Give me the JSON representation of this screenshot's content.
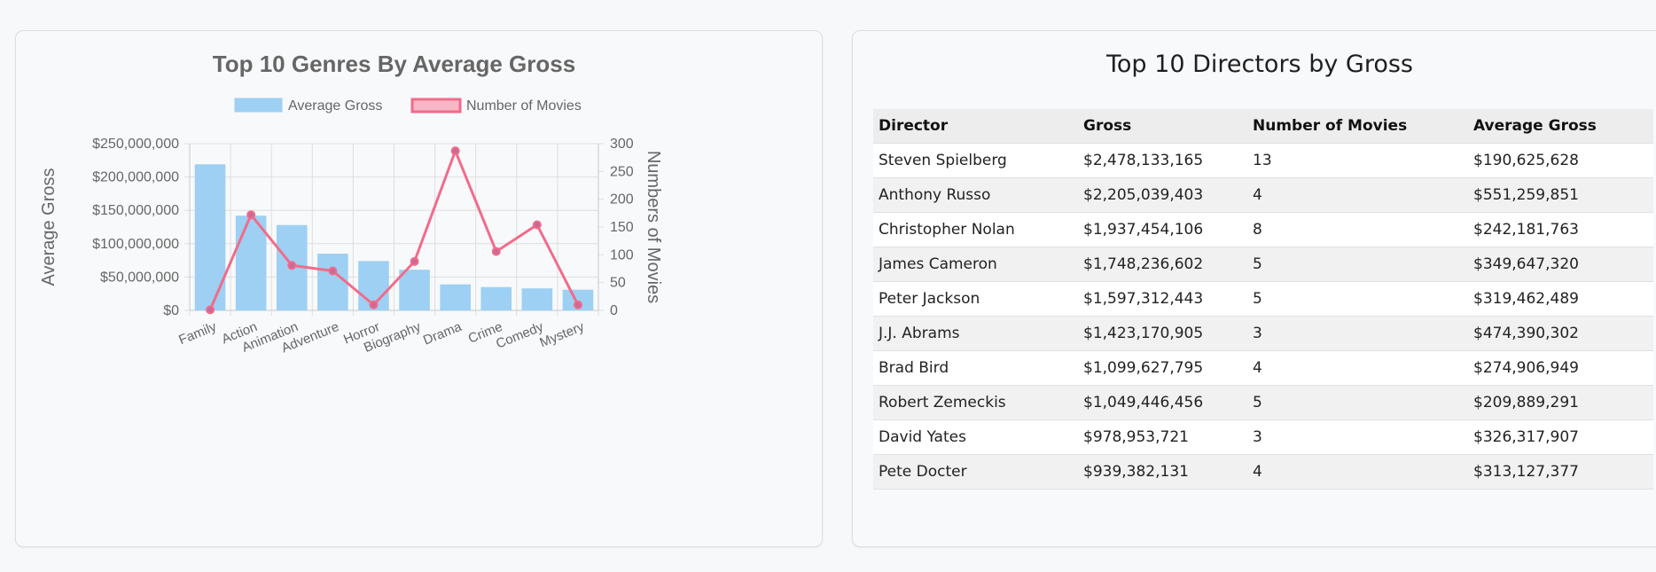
{
  "chart_data": {
    "type": "bar",
    "title": "Top 10 Genres By Average Gross",
    "categories": [
      "Family",
      "Action",
      "Animation",
      "Adventure",
      "Horror",
      "Biography",
      "Drama",
      "Crime",
      "Comedy",
      "Mystery"
    ],
    "series": [
      {
        "name": "Average Gross",
        "type": "bar",
        "axis": "left",
        "color": "#9dd0f3",
        "values": [
          219000000,
          142000000,
          128000000,
          85000000,
          74000000,
          61000000,
          39000000,
          35000000,
          33000000,
          31000000
        ]
      },
      {
        "name": "Number of Movies",
        "type": "line",
        "axis": "right",
        "color": "#f26b8a",
        "values": [
          1,
          172,
          81,
          71,
          10,
          88,
          287,
          106,
          154,
          10
        ]
      }
    ],
    "ylabel": "Average Gross",
    "y2label": "Numbers of Movies",
    "ylim": [
      0,
      250000000
    ],
    "y2lim": [
      0,
      300
    ],
    "yticks": [
      "$0",
      "$50,000,000",
      "$100,000,000",
      "$150,000,000",
      "$200,000,000",
      "$250,000,000"
    ],
    "y2ticks": [
      "0",
      "50",
      "100",
      "150",
      "200",
      "250",
      "300"
    ],
    "grid": true,
    "legend": "top"
  },
  "table": {
    "title": "Top 10 Directors by Gross",
    "columns": [
      "Director",
      "Gross",
      "Number of Movies",
      "Average Gross"
    ],
    "rows": [
      [
        "Steven Spielberg",
        "$2,478,133,165",
        "13",
        "$190,625,628"
      ],
      [
        "Anthony Russo",
        "$2,205,039,403",
        "4",
        "$551,259,851"
      ],
      [
        "Christopher Nolan",
        "$1,937,454,106",
        "8",
        "$242,181,763"
      ],
      [
        "James Cameron",
        "$1,748,236,602",
        "5",
        "$349,647,320"
      ],
      [
        "Peter Jackson",
        "$1,597,312,443",
        "5",
        "$319,462,489"
      ],
      [
        "J.J. Abrams",
        "$1,423,170,905",
        "3",
        "$474,390,302"
      ],
      [
        "Brad Bird",
        "$1,099,627,795",
        "4",
        "$274,906,949"
      ],
      [
        "Robert Zemeckis",
        "$1,049,446,456",
        "5",
        "$209,889,291"
      ],
      [
        "David Yates",
        "$978,953,721",
        "3",
        "$326,317,907"
      ],
      [
        "Pete Docter",
        "$939,382,131",
        "4",
        "$313,127,377"
      ]
    ]
  }
}
